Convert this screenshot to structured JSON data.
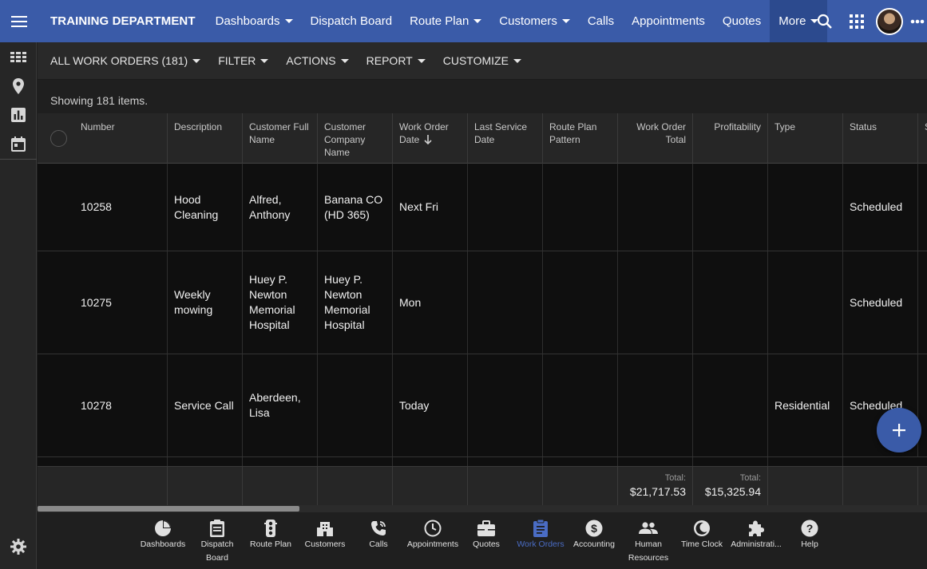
{
  "header": {
    "brand": "TRAINING DEPARTMENT",
    "nav": [
      {
        "label": "Dashboards",
        "dropdown": true
      },
      {
        "label": "Dispatch Board",
        "dropdown": false
      },
      {
        "label": "Route Plan",
        "dropdown": true
      },
      {
        "label": "Customers",
        "dropdown": true
      },
      {
        "label": "Calls",
        "dropdown": false
      },
      {
        "label": "Appointments",
        "dropdown": false
      },
      {
        "label": "Quotes",
        "dropdown": false
      },
      {
        "label": "More",
        "dropdown": true,
        "active": true
      }
    ],
    "icons": [
      "search-icon",
      "apps-grid-icon",
      "avatar",
      "more-horizontal-icon"
    ]
  },
  "sidebar": {
    "icons": [
      "grid-view-icon",
      "map-pin-icon",
      "bar-chart-icon",
      "calendar-icon"
    ],
    "bottom_icon": "gear-icon"
  },
  "toolbar": {
    "view_label": "ALL WORK ORDERS (181)",
    "filter_label": "FILTER",
    "actions_label": "ACTIONS",
    "report_label": "REPORT",
    "customize_label": "CUSTOMIZE"
  },
  "list": {
    "showing_text": "Showing 181 items."
  },
  "table": {
    "columns": [
      {
        "label": "Number"
      },
      {
        "label": "Description"
      },
      {
        "label": "Customer Full Name"
      },
      {
        "label": "Customer Company Name"
      },
      {
        "label": "Work Order Date",
        "sorted": "desc"
      },
      {
        "label": "Last Service Date"
      },
      {
        "label": "Route Plan Pattern"
      },
      {
        "label": "Work Order Total"
      },
      {
        "label": "Profitability"
      },
      {
        "label": "Type"
      },
      {
        "label": "Status"
      },
      {
        "label": "S"
      }
    ],
    "rows": [
      {
        "number": "10258",
        "description": "Hood Cleaning",
        "customer_full_name": "Alfred, Anthony",
        "company": "Banana CO (HD 365)",
        "date": "Next Fri",
        "last_service": "",
        "route_pattern": "",
        "total": "",
        "profitability": "",
        "type": "",
        "status": "Scheduled"
      },
      {
        "number": "10275",
        "description": "Weekly mowing",
        "customer_full_name": "Huey P. Newton Memorial Hospital",
        "company": "Huey P. Newton Memorial Hospital",
        "date": "Mon",
        "last_service": "",
        "route_pattern": "",
        "total": "",
        "profitability": "",
        "type": "",
        "status": "Scheduled"
      },
      {
        "number": "10278",
        "description": "Service Call",
        "customer_full_name": "Aberdeen, Lisa",
        "company": "",
        "date": "Today",
        "last_service": "",
        "route_pattern": "",
        "total": "",
        "profitability": "",
        "type": "Residential",
        "status": "Scheduled"
      }
    ],
    "footer": {
      "total_label": "Total:",
      "work_order_total": "$21,717.53",
      "profitability_total": "$15,325.94"
    }
  },
  "fab": {
    "icon": "plus-icon"
  },
  "bottom_nav": [
    {
      "label": "Dashboards",
      "icon": "pie-chart-icon"
    },
    {
      "label": "Dispatch Board",
      "icon": "clipboard-icon"
    },
    {
      "label": "Route Plan",
      "icon": "traffic-light-icon"
    },
    {
      "label": "Customers",
      "icon": "building-icon"
    },
    {
      "label": "Calls",
      "icon": "phone-icon"
    },
    {
      "label": "Appointments",
      "icon": "clock-icon"
    },
    {
      "label": "Quotes",
      "icon": "briefcase-icon"
    },
    {
      "label": "Work Orders",
      "icon": "clipboard-list-icon",
      "active": true
    },
    {
      "label": "Accounting",
      "icon": "dollar-icon"
    },
    {
      "label": "Human Resources",
      "icon": "people-icon"
    },
    {
      "label": "Time Clock",
      "icon": "moon-clock-icon"
    },
    {
      "label": "Administrati...",
      "icon": "puzzle-icon"
    },
    {
      "label": "Help",
      "icon": "help-icon"
    }
  ],
  "colors": {
    "header_bg": "#3a5ba8",
    "header_active": "#2c4a8e",
    "accent": "#4a6cc4",
    "body_bg": "#0f0f0f"
  }
}
